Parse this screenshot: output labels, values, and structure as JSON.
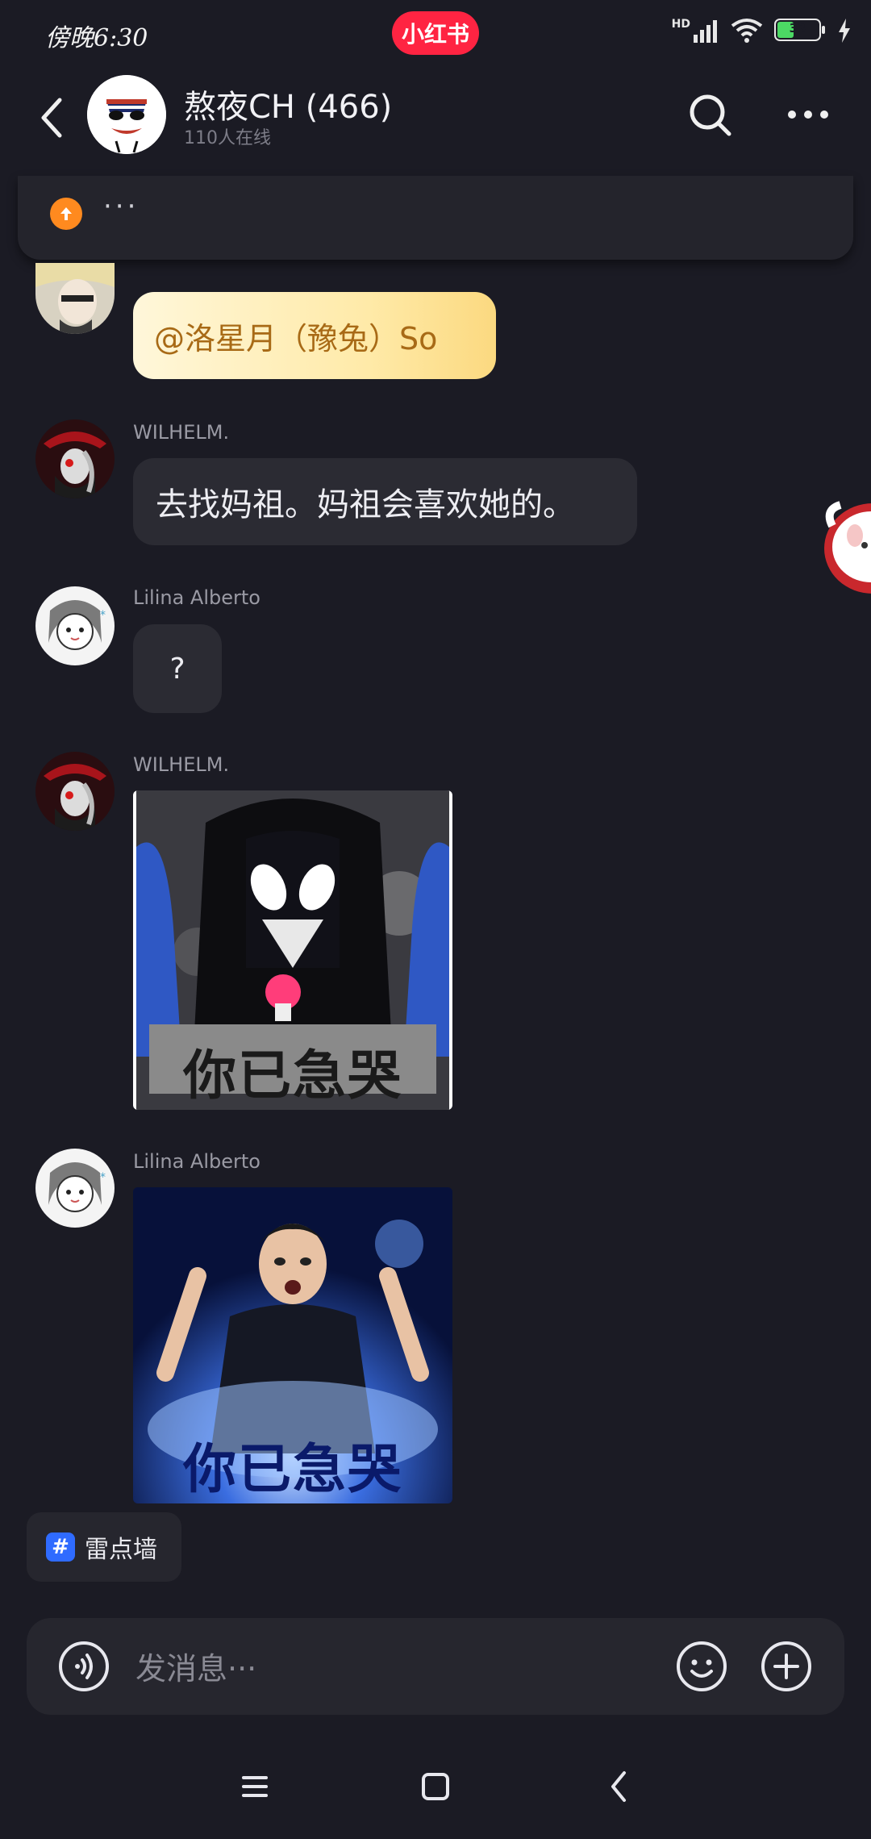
{
  "status_bar": {
    "time": "傍晚6:30",
    "app_badge": "小红书",
    "network_label": "HD",
    "battery_level": "33"
  },
  "header": {
    "title": "熬夜CH (466)",
    "subtitle": "110人在线"
  },
  "pinned": {
    "text": "···"
  },
  "messages": [
    {
      "sender": "",
      "text": "@洛星月（豫兔）So",
      "type": "gold-bubble"
    },
    {
      "sender": "WILHELM.",
      "text": "去找妈祖。妈祖会喜欢她的。",
      "type": "text"
    },
    {
      "sender": "Lilina Alberto",
      "text": "?",
      "type": "text"
    },
    {
      "sender": "WILHELM.",
      "type": "image",
      "caption": "你已急哭"
    },
    {
      "sender": "Lilina Alberto",
      "type": "image",
      "caption": "你已急哭"
    }
  ],
  "topic_chip": {
    "icon": "#",
    "label": "雷点墙"
  },
  "composer": {
    "placeholder": "发消息···"
  },
  "colors": {
    "background": "#1b1b24",
    "bubble": "#2b2b33",
    "brand_red": "#ff2442",
    "gold_text": "#a86a16",
    "topic_blue": "#2f6bff"
  }
}
